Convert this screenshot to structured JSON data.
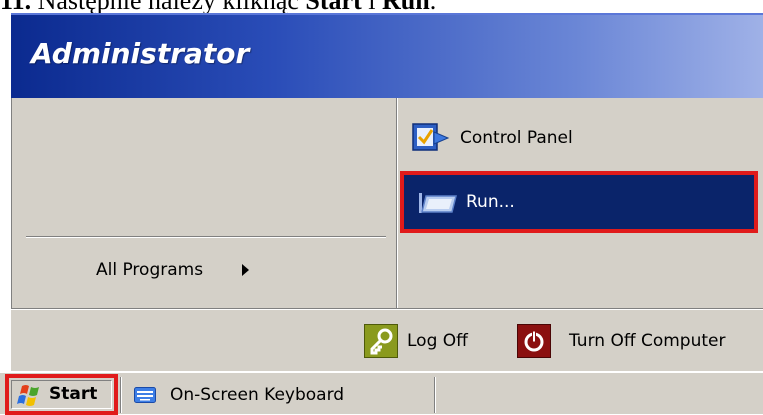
{
  "caption": {
    "number": "11.",
    "text_before": " Następnie należy kliknąć ",
    "start_word": "Start",
    "connector": " i ",
    "run_word": "Run",
    "period": "."
  },
  "start_menu": {
    "user_name": "Administrator",
    "all_programs_label": "All Programs",
    "right_items": [
      {
        "label": "Control Panel",
        "icon": "control-panel-icon"
      },
      {
        "label": "Run...",
        "icon": "run-icon",
        "highlighted": true
      }
    ],
    "bottom": {
      "log_off_label": "Log Off",
      "turn_off_label": "Turn Off Computer"
    }
  },
  "taskbar": {
    "start_label": "Start",
    "tasks": [
      {
        "label": "On-Screen Keyboard",
        "icon": "keyboard-icon"
      }
    ]
  },
  "colors": {
    "highlight_blue": "#0a246a",
    "annotation_red": "#e01b1b",
    "header_blue": "#0b2a8f",
    "face_gray": "#d4d0c8"
  }
}
